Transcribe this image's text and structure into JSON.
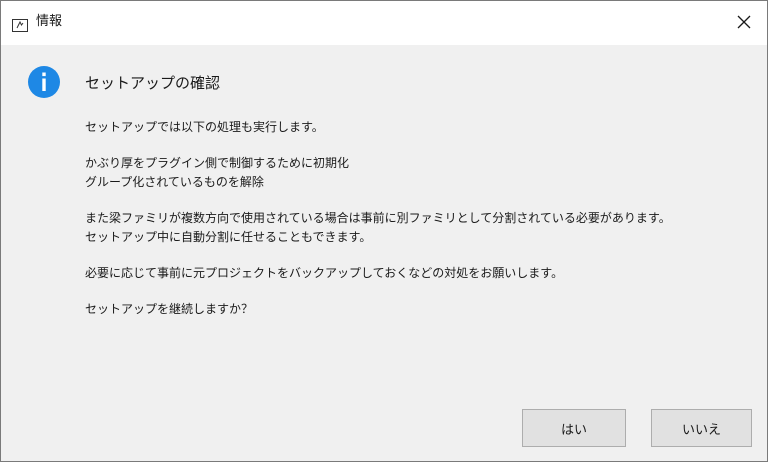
{
  "window": {
    "title": "情報",
    "close_label": "✕"
  },
  "dialog": {
    "heading": "セットアップの確認",
    "icon": "info-icon",
    "lines": [
      "セットアップでは以下の処理も実行します。",
      "かぶり厚をプラグイン側で制御するために初期化",
      "グループ化されているものを解除",
      "また梁ファミリが複数方向で使用されている場合は事前に別ファミリとして分割されている必要があります。",
      "セットアップ中に自動分割に任せることもできます。",
      "必要に応じて事前に元プロジェクトをバックアップしておくなどの対処をお願いします。",
      "セットアップを継続しますか？"
    ]
  },
  "buttons": {
    "yes": "はい",
    "no": "いいえ"
  },
  "colors": {
    "info_blue": "#1e88e5",
    "content_bg": "#f0f0f0",
    "button_bg": "#e1e1e1"
  }
}
